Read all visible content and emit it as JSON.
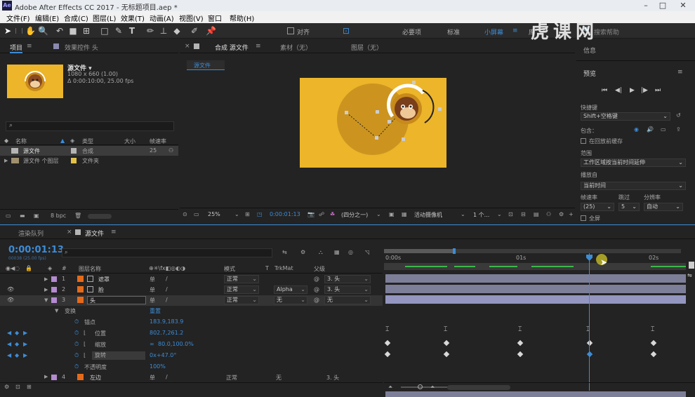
{
  "window": {
    "title": "Adobe After Effects CC 2017 - 无标题项目.aep *",
    "app_icon": "Ae"
  },
  "menu": [
    "文件(F)",
    "编辑(E)",
    "合成(C)",
    "图层(L)",
    "效果(T)",
    "动画(A)",
    "视图(V)",
    "窗口",
    "帮助(H)"
  ],
  "toolbar": {
    "snap_label": "对齐",
    "workspaces": [
      "必要项",
      "标准",
      "小屏幕"
    ],
    "active_workspace": "小屏幕",
    "library_label": "库",
    "search_placeholder": "搜索帮助"
  },
  "project_panel": {
    "tab_project": "项目",
    "tab_effects": "效果控件 头",
    "item_name": "源文件 ▾",
    "item_info1": "1080 x 660 (1.00)",
    "item_info2": "Δ 0:00:10:00, 25.00 fps",
    "search_placeholder": "",
    "columns": [
      "名称",
      "类型",
      "大小",
      "帧速率"
    ],
    "rows": [
      {
        "name": "源文件",
        "type": "合成",
        "size": "",
        "fps": "25",
        "color": "#b4b4b4"
      },
      {
        "name": "源文件 个图层",
        "type": "文件夹",
        "size": "",
        "fps": "",
        "color": "#e2c248"
      }
    ],
    "bpc": "8 bpc"
  },
  "comp_panel": {
    "tab_comp": "合成 源文件",
    "tab_footage": "素材（无）",
    "tab_layer": "图层（无）",
    "subtab": "源文件",
    "zoom": "25%",
    "timecode": "0:00:01:13",
    "resolution": "(四分之一)",
    "camera": "活动摄像机",
    "views": "1 个...",
    "bg_color": "#ecb52a"
  },
  "right_panel": {
    "info": "信息",
    "preview": "预览",
    "shortcut_label": "快捷键",
    "shortcut_value": "Shift+空格键",
    "include_label": "包含：",
    "cache_label": "在回放前缓存",
    "range_label": "范围",
    "range_value": "工作区域按当前时间延伸",
    "play_from_label": "播放自",
    "play_from_value": "当前时间",
    "fps_label": "帧速率",
    "skip_label": "跳过",
    "res_label": "分辨率",
    "fps_value": "(25)",
    "skip_value": "5",
    "res_value": "自动",
    "fullscreen_label": "全屏"
  },
  "timeline": {
    "tab_render": "渲染队列",
    "tab_comp": "源文件",
    "timecode": "0:00:01:13",
    "timecode_sub": "00038 (25.00 fps)",
    "col_layer_name": "图层名称",
    "col_mode": "模式",
    "col_t": "T",
    "col_trkmat": "TrkMat",
    "col_parent": "父级",
    "ruler": [
      "0:00s",
      "01s",
      "02s"
    ],
    "layers": [
      {
        "num": "1",
        "name": "遮罩",
        "mode": "正常",
        "trkmat": "",
        "parent": "3. 头",
        "label": "#b48ad0"
      },
      {
        "num": "2",
        "name": "脸",
        "mode": "正常",
        "trkmat": "Alpha",
        "parent": "3. 头",
        "label": "#b48ad0"
      },
      {
        "num": "3",
        "name": "头",
        "mode": "正常",
        "trkmat": "无",
        "parent": "无",
        "label": "#b48ad0"
      },
      {
        "num": "4",
        "name": "左边",
        "mode": "正常",
        "trkmat": "无",
        "parent": "3. 头",
        "label": "#b48ad0"
      }
    ],
    "transform_label": "变换",
    "reset_label": "重置",
    "props": [
      {
        "name": "锚点",
        "value": "183.9,183.9"
      },
      {
        "name": "位置",
        "value": "802.7,261.2"
      },
      {
        "name": "缩放",
        "value": "80.0,100.0%"
      },
      {
        "name": "旋转",
        "value": "0x+47.0°"
      },
      {
        "name": "不透明度",
        "value": "100%"
      }
    ]
  },
  "watermark": "虎课网"
}
